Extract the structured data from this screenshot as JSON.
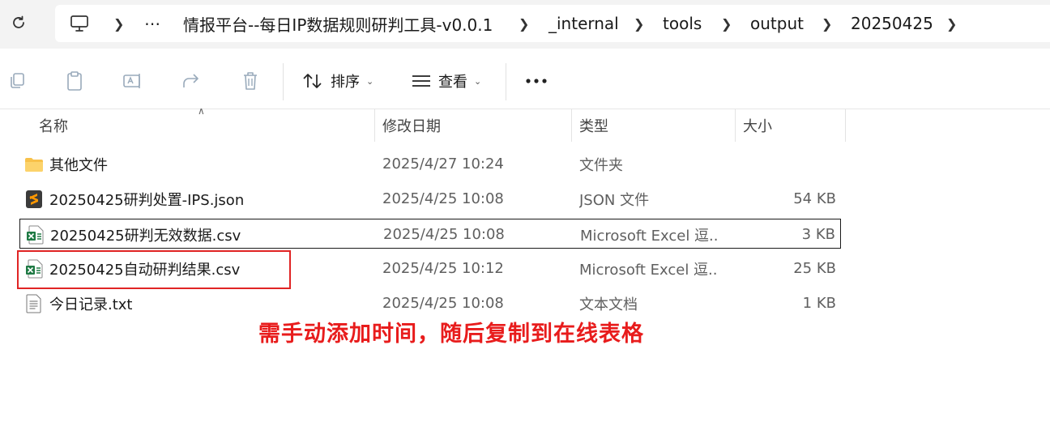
{
  "address_bar": {
    "crumbs": [
      "情报平台--每日IP数据规则研判工具-v0.0.1",
      "_internal",
      "tools",
      "output",
      "20250425"
    ],
    "icons": {
      "refresh": "refresh-icon",
      "this_pc": "computer-icon",
      "more": "ellipsis-icon"
    }
  },
  "command_bar": {
    "sort_label": "排序",
    "view_label": "查看",
    "icons": [
      "copy-icon",
      "paste-icon",
      "rename-icon",
      "share-icon",
      "delete-icon",
      "sort-icon",
      "view-icon",
      "more-icon"
    ]
  },
  "columns": {
    "name": "名称",
    "date": "修改日期",
    "type": "类型",
    "size": "大小"
  },
  "files": [
    {
      "name": "其他文件",
      "date": "2025/4/27 10:24",
      "type": "文件夹",
      "size": "",
      "icon": "folder-icon"
    },
    {
      "name": "20250425研判处置-IPS.json",
      "date": "2025/4/25 10:08",
      "type": "JSON 文件",
      "size": "54 KB",
      "icon": "sublime-file-icon"
    },
    {
      "name": "20250425研判无效数据.csv",
      "date": "2025/4/25 10:08",
      "type": "Microsoft Excel 逗...",
      "size": "3 KB",
      "icon": "excel-file-icon"
    },
    {
      "name": "20250425自动研判结果.csv",
      "date": "2025/4/25 10:12",
      "type": "Microsoft Excel 逗...",
      "size": "25 KB",
      "icon": "excel-file-icon"
    },
    {
      "name": "今日记录.txt",
      "date": "2025/4/25 10:08",
      "type": "文本文档",
      "size": "1 KB",
      "icon": "text-file-icon"
    }
  ],
  "annotation": "需手动添加时间，随后复制到在线表格",
  "colors": {
    "annotation": "#e81c1c",
    "highlight_border": "#e02424",
    "folder": "#f8c14a",
    "excel": "#1f7a44"
  }
}
